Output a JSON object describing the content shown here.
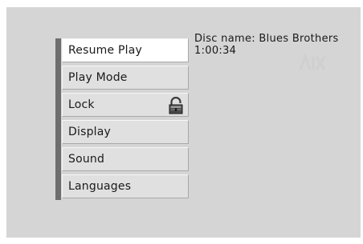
{
  "menu": {
    "items": [
      {
        "label": "Resume Play",
        "selected": true
      },
      {
        "label": "Play Mode"
      },
      {
        "label": "Lock",
        "icon": "padlock-icon"
      },
      {
        "label": "Display"
      },
      {
        "label": "Sound"
      },
      {
        "label": "Languages"
      }
    ]
  },
  "info": {
    "disc_name": "Disc name: Blues Brothers",
    "time": "1:00:34"
  },
  "colors": {
    "screen_background": "#d5d5d5",
    "menu_accent_bar": "#6e6e6e",
    "menu_item_background": "#e0e0e0",
    "selected_item_background": "#ffffff"
  }
}
